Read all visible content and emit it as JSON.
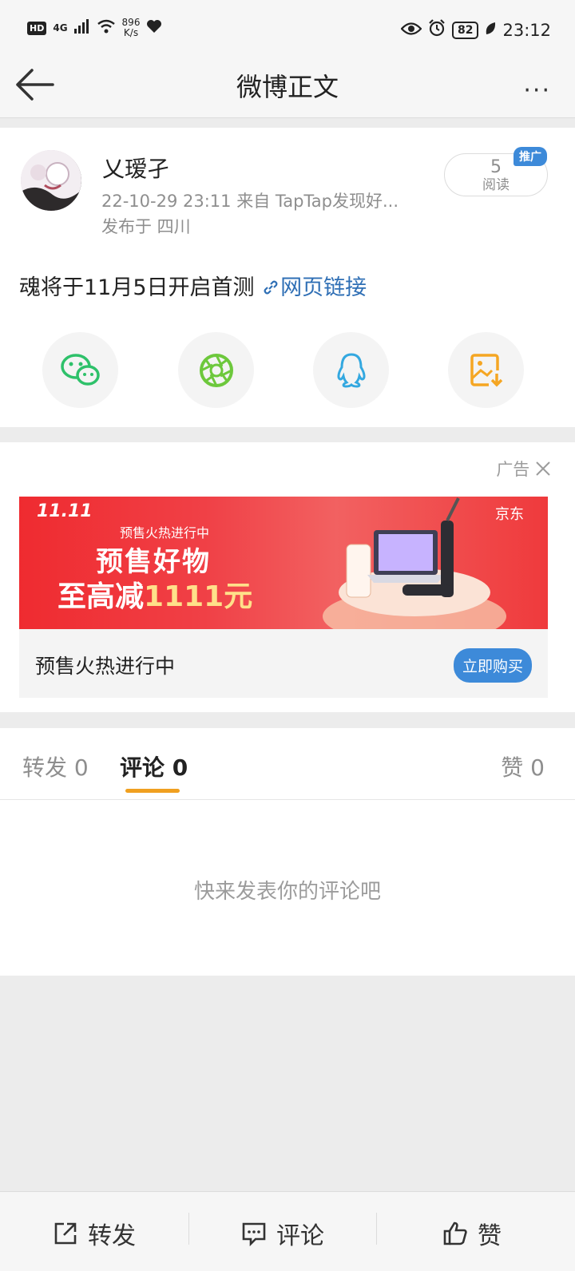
{
  "status_bar": {
    "hd": "HD",
    "network_type": "4G",
    "net_speed_value": "896",
    "net_speed_unit": "K/s",
    "battery": "82",
    "time": "23:12"
  },
  "nav": {
    "title": "微博正文",
    "more": "···"
  },
  "post": {
    "author": "乂瑷孑",
    "meta": "22-10-29 23:11   来自 TapTap发现好...",
    "location": "发布于 四川",
    "read_count": "5",
    "read_label": "阅读",
    "promo_badge": "推广",
    "text": "魂将于11月5日开启首测 ",
    "link_text": "网页链接",
    "share_icons": [
      "wechat-icon",
      "moments-icon",
      "qq-icon",
      "save-image-icon"
    ]
  },
  "ad": {
    "label": "广告",
    "banner_tag": "11.11",
    "banner_presale": "预售火热进行中",
    "banner_headline": "预售好物",
    "banner_sub_prefix": "至高减",
    "banner_amount": "1111元",
    "banner_brand": "京东",
    "title": "预售火热进行中",
    "button": "立即购买"
  },
  "tabs": {
    "repost": "转发 0",
    "comment": "评论 0",
    "like": "赞 0"
  },
  "comments": {
    "empty": "快来发表你的评论吧"
  },
  "bottom_bar": {
    "repost": "转发",
    "comment": "评论",
    "like": "赞"
  },
  "colors": {
    "accent_blue": "#3d8ad9",
    "link_blue": "#2f6fb5",
    "tab_underline": "#f0a020",
    "wechat_green": "#2ec16a",
    "moments_green": "#6dc83c",
    "qq_blue": "#33a8e0",
    "save_orange": "#f5a623"
  }
}
